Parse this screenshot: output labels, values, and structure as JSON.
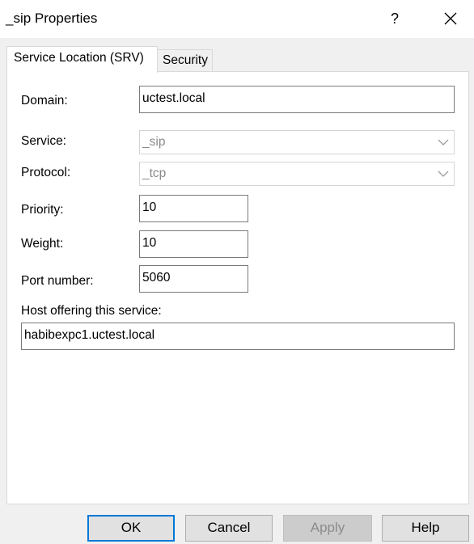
{
  "window": {
    "title": "_sip Properties",
    "help_glyph": "?"
  },
  "tabs": [
    {
      "label": "Service Location (SRV)",
      "selected": true
    },
    {
      "label": "Security",
      "selected": false
    }
  ],
  "form": {
    "domain_label": "Domain:",
    "domain_value": "uctest.local",
    "service_label": "Service:",
    "service_value": "_sip",
    "protocol_label": "Protocol:",
    "protocol_value": "_tcp",
    "priority_label": "Priority:",
    "priority_value": "10",
    "weight_label": "Weight:",
    "weight_value": "10",
    "port_label": "Port number:",
    "port_value": "5060",
    "host_label": "Host offering this service:",
    "host_value": "habibexpc1.uctest.local"
  },
  "buttons": {
    "ok": "OK",
    "cancel": "Cancel",
    "apply": "Apply",
    "help": "Help"
  },
  "icons": {
    "help": "help-question-icon",
    "close": "close-icon",
    "dropdown": "chevron-down-icon"
  },
  "colors": {
    "default_button_border": "#0078d7",
    "dialog_background": "#f0f0f0",
    "panel_background": "#ffffff"
  }
}
